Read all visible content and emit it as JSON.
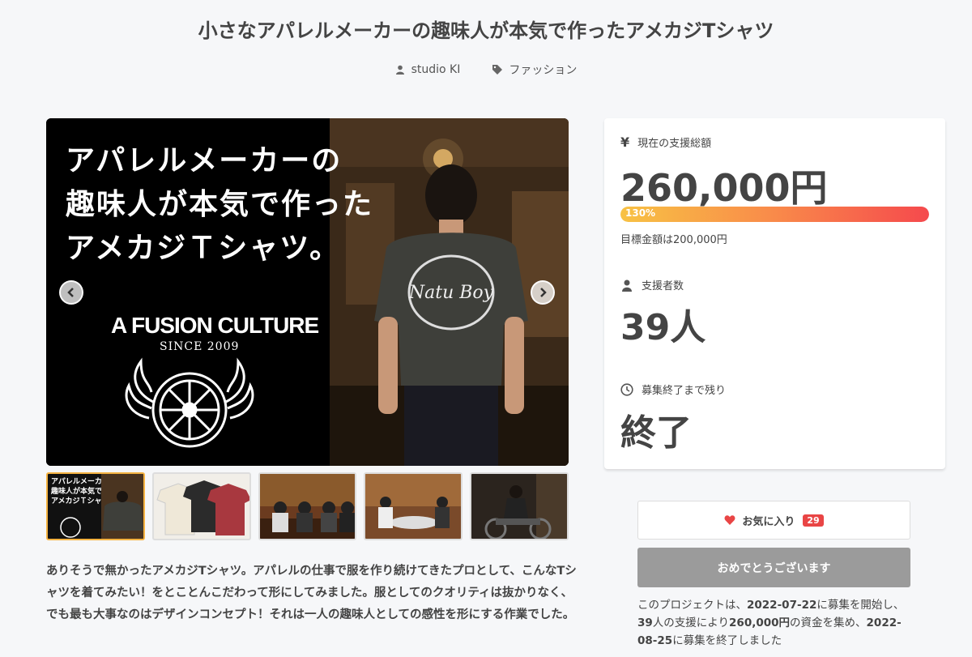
{
  "page": {
    "title": "小さなアパレルメーカーの趣味人が本気で作ったアメカジTシャツ",
    "author": "studio KI",
    "category": "ファッション"
  },
  "hero": {
    "headline": [
      "アパレルメーカーの",
      "趣味人が本気で作った",
      "アメカジＴシャツ。"
    ],
    "logo_text": "A FUSION CULTURE",
    "logo_since": "SINCE 2009",
    "shirt_text": "Natu Boy"
  },
  "thumbnails": [
    {
      "label": "thumb-1",
      "text": [
        "アパレルメーカーの",
        "趣味人が本気で作った",
        "アメカジＴシャツ。"
      ],
      "color": "#111111"
    },
    {
      "label": "thumb-2",
      "color": "#e8e4dc"
    },
    {
      "label": "thumb-3",
      "color": "#6b3b1f"
    },
    {
      "label": "thumb-4",
      "color": "#7a4a2a"
    },
    {
      "label": "thumb-5",
      "color": "#2b241e"
    }
  ],
  "description": "ありそうで無かったアメカジTシャツ。アパレルの仕事で服を作り続けてきたプロとして、こんなTシャツを着てみたい！をとことんこだわって形にしてみました。服としてのクオリティは抜かりなく、でも最も大事なのはデザインコンセプト！それは一人の趣味人としての感性を形にする作業でした。",
  "stats": {
    "amount_label": "現在の支援総額",
    "amount": "260,000円",
    "progress_percent": 130,
    "progress_text": "130%",
    "goal": "目標金額は200,000円",
    "backers_label": "支援者数",
    "backers": "39人",
    "remaining_label": "募集終了まで残り",
    "remaining": "終了"
  },
  "favorite": {
    "label": "お気に入り",
    "count": "29"
  },
  "done_button": "おめでとうございます",
  "summary": {
    "p1": "このプロジェクトは、",
    "start": "2022-07-22",
    "p2": "に募集を開始し、",
    "backers": "39",
    "p3": "人の支援により",
    "amount": "260,000円",
    "p4": "の資金を集め、",
    "end": "2022-08-25",
    "p5": "に募集を終了しました"
  },
  "colors": {
    "accent_red": "#e94545",
    "progress_start": "#f8c244",
    "progress_end": "#f5494d",
    "done_gray": "#9b9b9b"
  }
}
